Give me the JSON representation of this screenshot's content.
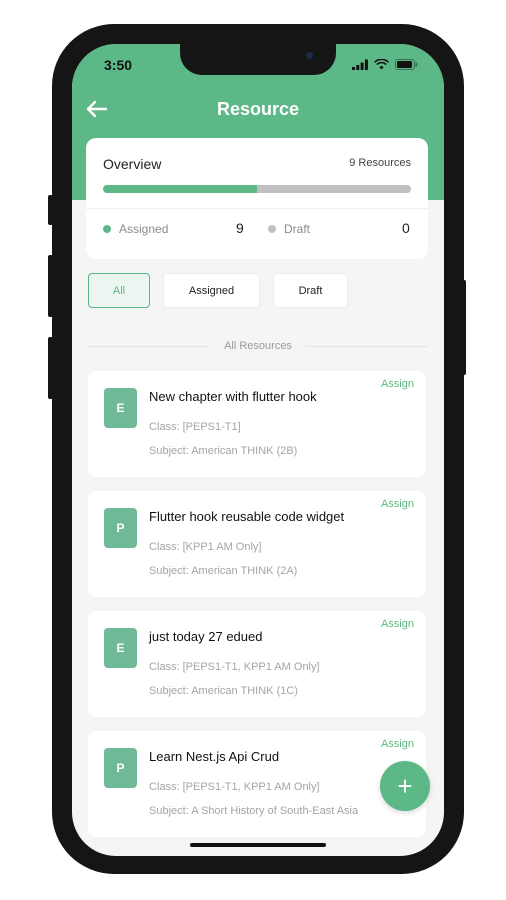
{
  "status_bar": {
    "time": "3:50"
  },
  "header": {
    "title": "Resource"
  },
  "overview": {
    "title": "Overview",
    "count_label": "9 Resources",
    "progress_fraction": 0.5,
    "assigned_label": "Assigned",
    "assigned_value": "9",
    "draft_label": "Draft",
    "draft_value": "0"
  },
  "filters": [
    {
      "label": "All",
      "active": true
    },
    {
      "label": "Assigned",
      "active": false
    },
    {
      "label": "Draft",
      "active": false
    }
  ],
  "section_label": "All Resources",
  "resources": [
    {
      "badge": "E",
      "title": "New chapter with flutter hook",
      "class": "Class: [PEPS1-T1]",
      "subject": "Subject: American THINK (2B)",
      "action": "Assign"
    },
    {
      "badge": "P",
      "title": "Flutter hook reusable code widget",
      "class": "Class: [KPP1 AM Only]",
      "subject": "Subject: American THINK (2A)",
      "action": "Assign"
    },
    {
      "badge": "E",
      "title": "just today 27 edued",
      "class": "Class: [PEPS1-T1, KPP1 AM Only]",
      "subject": "Subject: American THINK (1C)",
      "action": "Assign"
    },
    {
      "badge": "P",
      "title": "Learn Nest.js Api Crud",
      "class": "Class: [PEPS1-T1, KPP1 AM Only]",
      "subject": "Subject: A Short History of South-East Asia",
      "action": "Assign"
    }
  ],
  "fab": {
    "label": "+"
  },
  "colors": {
    "accent": "#5cb886",
    "badge": "#6fb996",
    "draft_dot": "#c0c0c0"
  }
}
